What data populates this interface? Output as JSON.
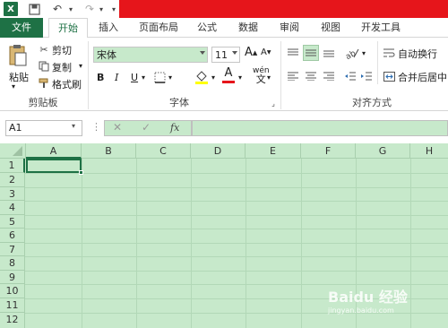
{
  "quick_access": {
    "logo": "X",
    "save": "save-icon",
    "undo": "undo-icon",
    "redo": "redo-icon"
  },
  "tabs": [
    "文件",
    "开始",
    "插入",
    "页面布局",
    "公式",
    "数据",
    "审阅",
    "视图",
    "开发工具"
  ],
  "clipboard": {
    "paste": "粘贴",
    "cut": "剪切",
    "copy": "复制",
    "format_painter": "格式刷",
    "group": "剪贴板"
  },
  "font": {
    "name": "宋体",
    "size": "11",
    "bold": "B",
    "italic": "I",
    "underline": "U",
    "grow": "A",
    "shrink": "A",
    "color_letter": "A",
    "wen": "wén",
    "wen_char": "文",
    "group": "字体"
  },
  "alignment": {
    "wrap": "自动换行",
    "merge": "合并后居中",
    "group": "对齐方式"
  },
  "formula_bar": {
    "name_box": "A1",
    "fx": "fx",
    "cancel": "✕",
    "enter": "✓"
  },
  "columns": [
    "A",
    "B",
    "C",
    "D",
    "E",
    "F",
    "G",
    "H"
  ],
  "rows": [
    "1",
    "2",
    "3",
    "4",
    "5",
    "6",
    "7",
    "8",
    "9",
    "10",
    "11",
    "12"
  ],
  "watermark": {
    "text": "Baidu 经验",
    "sub": "jingyan.baidu.com"
  },
  "colors": {
    "excel_green": "#1e7145",
    "title_red": "#e6151b",
    "sheet_bg": "#c7e9cb"
  }
}
